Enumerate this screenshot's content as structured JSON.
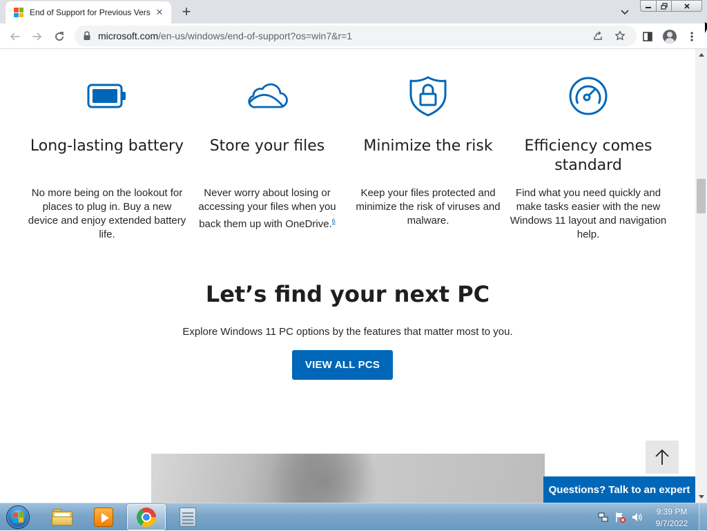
{
  "browser": {
    "tab_title": "End of Support for Previous Vers",
    "tab_close": "✕",
    "new_tab": "+",
    "url_host": "microsoft.com",
    "url_path": "/en-us/windows/end-of-support?os=win7&r=1"
  },
  "colors": {
    "accent": "#0067b8",
    "tab_strip": "#dee1e6",
    "taskbar": "#7aa5c9"
  },
  "features": [
    {
      "icon": "battery-icon",
      "title": "Long-lasting battery",
      "text": "No more being on the lookout for places to plug in. Buy a new device and enjoy extended battery life."
    },
    {
      "icon": "cloud-icon",
      "title": "Store your files",
      "text": "Never worry about losing or accessing your files when you back them up with OneDrive.",
      "footnote": "6"
    },
    {
      "icon": "shield-lock-icon",
      "title": "Minimize the risk",
      "text": "Keep your files protected and minimize the risk of viruses and malware."
    },
    {
      "icon": "speedometer-icon",
      "title": "Efficiency comes standard",
      "text": "Find what you need quickly and make tasks easier with the new Windows 11 layout and navigation help."
    }
  ],
  "section": {
    "title": "Let’s find your next PC",
    "subtitle": "Explore Windows 11 PC options by the features that matter most to you.",
    "cta_label": "VIEW ALL PCS"
  },
  "chat": {
    "label": "Questions? Talk to an expert"
  },
  "taskbar": {
    "apps": [
      "explorer-icon",
      "media-player-icon",
      "chrome-icon",
      "notepad-icon"
    ],
    "active_app": "chrome-icon",
    "time": "9:39 PM",
    "date": "9/7/2022"
  }
}
